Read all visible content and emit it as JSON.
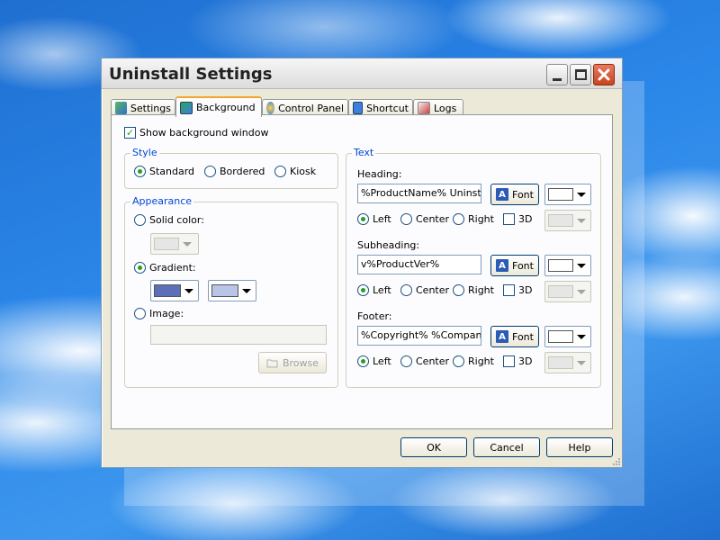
{
  "window": {
    "title": "Uninstall Settings"
  },
  "tabs": [
    {
      "label": "Settings",
      "icon": "settings-icon"
    },
    {
      "label": "Background",
      "icon": "background-icon",
      "active": true
    },
    {
      "label": "Control Panel",
      "icon": "control-panel-icon"
    },
    {
      "label": "Shortcut",
      "icon": "shortcut-icon"
    },
    {
      "label": "Logs",
      "icon": "logs-icon"
    }
  ],
  "show_background": {
    "label": "Show background window",
    "checked": true
  },
  "style": {
    "legend": "Style",
    "options": [
      "Standard",
      "Bordered",
      "Kiosk"
    ],
    "selected": "Standard"
  },
  "appearance": {
    "legend": "Appearance",
    "solid_label": "Solid color:",
    "gradient_label": "Gradient:",
    "image_label": "Image:",
    "image_value": "",
    "browse_label": "Browse",
    "selected": "Gradient",
    "solid_color": "#e6e6e6",
    "gradient_start": "#5b70b8",
    "gradient_end": "#b8c4e8"
  },
  "text": {
    "legend": "Text",
    "font_label": "Font",
    "align_left": "Left",
    "align_center": "Center",
    "align_right": "Right",
    "three_d": "3D",
    "heading": {
      "label": "Heading:",
      "value": "%ProductName% Uninstall",
      "align": "Left",
      "color": "#ffffff"
    },
    "subheading": {
      "label": "Subheading:",
      "value": "v%ProductVer%",
      "align": "Left",
      "color": "#ffffff"
    },
    "footer": {
      "label": "Footer:",
      "value": "%Copyright% %CompanyNa",
      "align": "Left",
      "color": "#ffffff"
    }
  },
  "buttons": {
    "ok": "OK",
    "cancel": "Cancel",
    "help": "Help"
  }
}
